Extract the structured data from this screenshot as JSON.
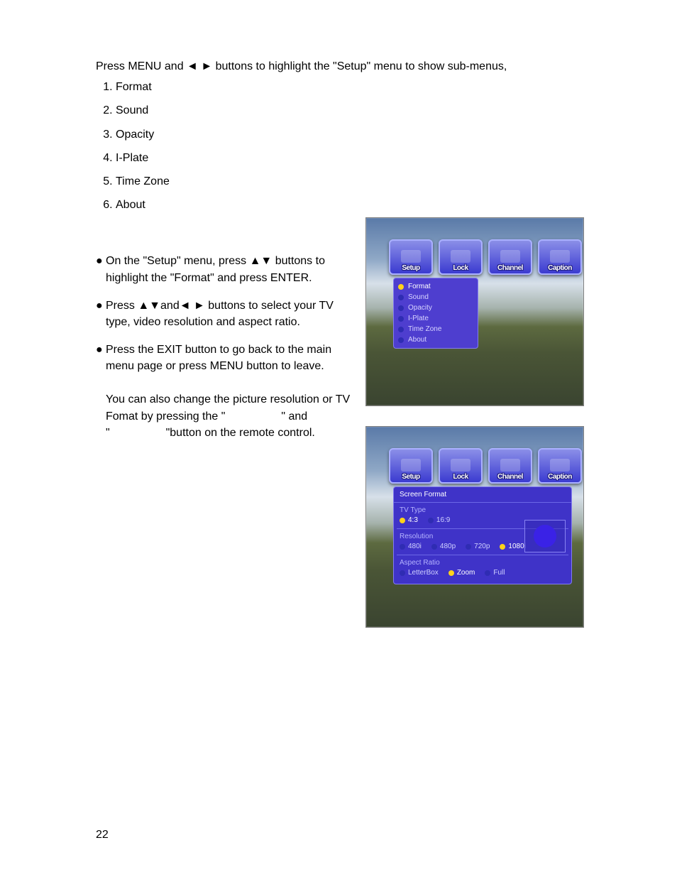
{
  "intro": "Press MENU and ◄ ► buttons to highlight the \"Setup\" menu to show sub-menus,",
  "list": [
    "Format",
    "Sound",
    "Opacity",
    "I-Plate",
    "Time Zone",
    "About"
  ],
  "bullets": [
    "On the \"Setup\" menu, press ▲▼ buttons to highlight the \"Format\" and press ENTER.",
    "Press ▲▼and◄ ► buttons to select your TV type, video resolution and aspect ratio.",
    "Press the EXIT button to go back to the main menu page or press MENU button to leave."
  ],
  "remote_note_1": "You can also change the picture resolution or TV",
  "remote_note_2": "Fomat by pressing the \"",
  "remote_note_3": "\" and",
  "remote_note_4": "\"",
  "remote_note_5": "\"button on the remote control.",
  "page_number": "22",
  "tabs": [
    "Setup",
    "Lock",
    "Channel",
    "Caption"
  ],
  "shot1_menu": [
    {
      "label": "Format",
      "selected": true
    },
    {
      "label": "Sound",
      "selected": false
    },
    {
      "label": "Opacity",
      "selected": false
    },
    {
      "label": "I-Plate",
      "selected": false
    },
    {
      "label": "Time Zone",
      "selected": false
    },
    {
      "label": "About",
      "selected": false
    }
  ],
  "panel": {
    "title": "Screen  Format",
    "tv_type": {
      "label": "TV  Type",
      "options": [
        {
          "label": "4:3",
          "selected": true
        },
        {
          "label": "16:9",
          "selected": false
        }
      ]
    },
    "resolution": {
      "label": "Resolution",
      "options": [
        {
          "label": "480i",
          "selected": false
        },
        {
          "label": "480p",
          "selected": false
        },
        {
          "label": "720p",
          "selected": false
        },
        {
          "label": "1080i",
          "selected": true
        }
      ]
    },
    "aspect": {
      "label": "Aspect  Ratio",
      "options": [
        {
          "label": "LetterBox",
          "selected": false
        },
        {
          "label": "Zoom",
          "selected": true
        },
        {
          "label": "Full",
          "selected": false
        }
      ]
    }
  }
}
